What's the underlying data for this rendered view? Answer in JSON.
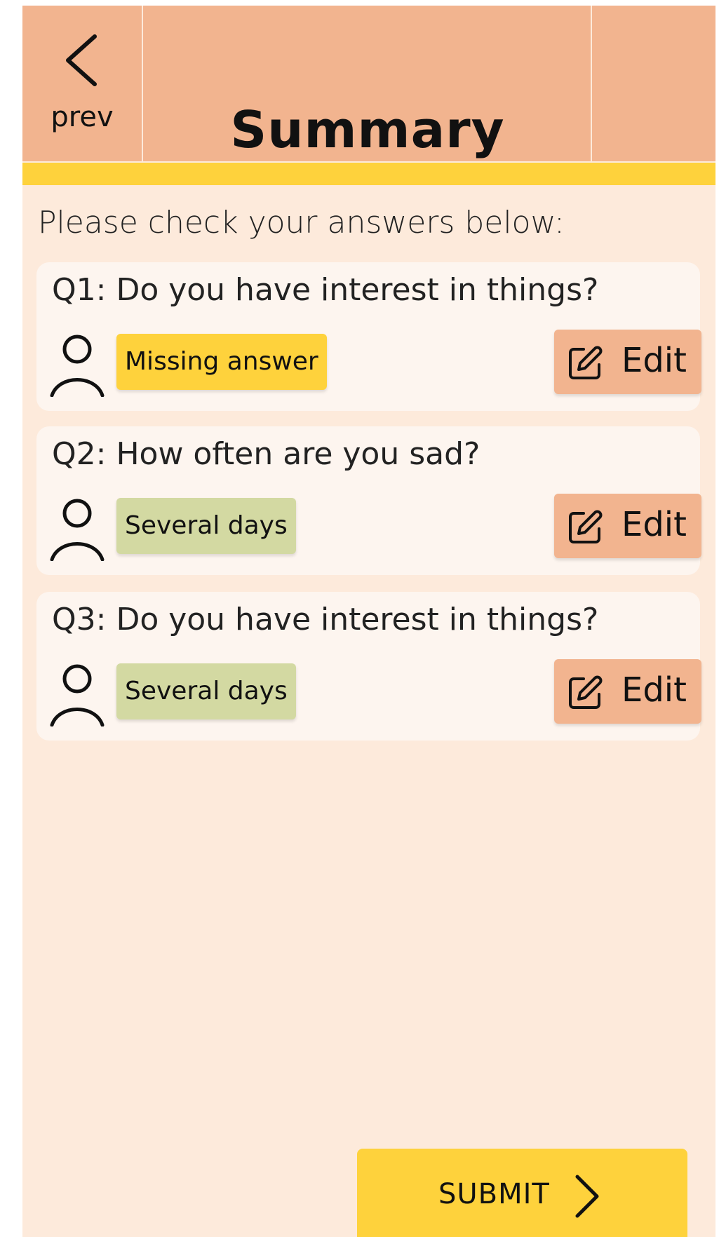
{
  "header": {
    "prev_label": "prev",
    "title": "Summary"
  },
  "intro": "Please check your answers below:",
  "questions": [
    {
      "question": "Q1: Do you have interest in things?",
      "answer": "Missing answer",
      "status": "missing",
      "edit_label": "Edit"
    },
    {
      "question": "Q2: How often are you sad?",
      "answer": "Several days",
      "status": "answered",
      "edit_label": "Edit"
    },
    {
      "question": "Q3: Do you have interest in things?",
      "answer": "Several days",
      "status": "answered",
      "edit_label": "Edit"
    }
  ],
  "submit_label": "SUBMIT",
  "icons": {
    "prev": "chevron-left-icon",
    "person": "person-icon",
    "edit": "pencil-square-icon",
    "submit": "chevron-right-icon"
  },
  "colors": {
    "background": "#fdeadb",
    "header": "#f2b48f",
    "accent": "#fed23c",
    "card": "#fdf5ef",
    "answer_given": "#d3d9a2",
    "answer_missing": "#fed23c"
  }
}
